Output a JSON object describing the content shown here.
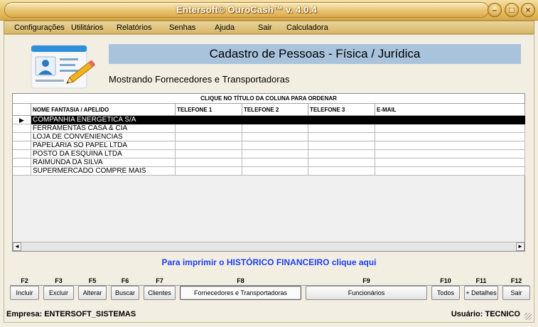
{
  "window": {
    "title": "Entersoft© OuroCash™ v. 4.0.4",
    "controls": [
      "minimize-icon",
      "maximize-icon",
      "close-icon"
    ]
  },
  "menu": {
    "items": [
      {
        "label": "Configurações"
      },
      {
        "label": "Utilitários"
      },
      {
        "label": "Relatórios"
      },
      {
        "label": "Senhas"
      },
      {
        "label": "Ajuda"
      },
      {
        "label": "Sair"
      },
      {
        "label": "Calculadora"
      }
    ]
  },
  "header": {
    "title": "Cadastro de Pessoas - Física / Jurídica",
    "subtitle": "Mostrando Fornecedores e Transportadoras",
    "logo_icon": "person-card-icon"
  },
  "grid": {
    "caption": "CLIQUE NO TÍTULO DA COLUNA PARA ORDENAR",
    "columns": [
      "NOME FANTASIA / APELIDO",
      "TELEFONE 1",
      "TELEFONE 2",
      "TELEFONE 3",
      "E-MAIL"
    ],
    "row_indicator": "▶",
    "rows": [
      {
        "name": "COMPANHIA ENERGÉTICA S/A",
        "tel1": "",
        "tel2": "",
        "tel3": "",
        "email": "",
        "selected": true
      },
      {
        "name": "FERRAMENTAS CASA & CIA",
        "tel1": "",
        "tel2": "",
        "tel3": "",
        "email": ""
      },
      {
        "name": "LOJA DE CONVENIENCIAS",
        "tel1": "",
        "tel2": "",
        "tel3": "",
        "email": ""
      },
      {
        "name": "PAPELARIA SÓ PAPEL LTDA",
        "tel1": "",
        "tel2": "",
        "tel3": "",
        "email": ""
      },
      {
        "name": "POSTO DA ESQUINA LTDA",
        "tel1": "",
        "tel2": "",
        "tel3": "",
        "email": ""
      },
      {
        "name": "RAIMUNDA DA SILVA",
        "tel1": "",
        "tel2": "",
        "tel3": "",
        "email": ""
      },
      {
        "name": "SUPERMERCADO COMPRE MAIS",
        "tel1": "",
        "tel2": "",
        "tel3": "",
        "email": ""
      }
    ],
    "scroll_left": "◄",
    "scroll_right": "►"
  },
  "print_link": "Para imprimir o HISTÓRICO FINANCEIRO  clique aqui",
  "fkeys": [
    {
      "key": "F2",
      "label": "Incluir"
    },
    {
      "key": "F3",
      "label": "Excluir"
    },
    {
      "key": "F5",
      "label": "Alterar"
    },
    {
      "key": "F6",
      "label": "Buscar"
    },
    {
      "key": "F7",
      "label": "Clientes"
    },
    {
      "key": "F8",
      "label": "Fornecedores  e  Transportadoras",
      "active": true
    },
    {
      "key": "F9",
      "label": "Funcionários"
    },
    {
      "key": "F10",
      "label": "Todos"
    },
    {
      "key": "F11",
      "label": "+ Detalhes"
    },
    {
      "key": "F12",
      "label": "Sair"
    }
  ],
  "status": {
    "company": "Empresa: ENTERSOFT_SISTEMAS",
    "user": "Usuário: TECNICO"
  }
}
